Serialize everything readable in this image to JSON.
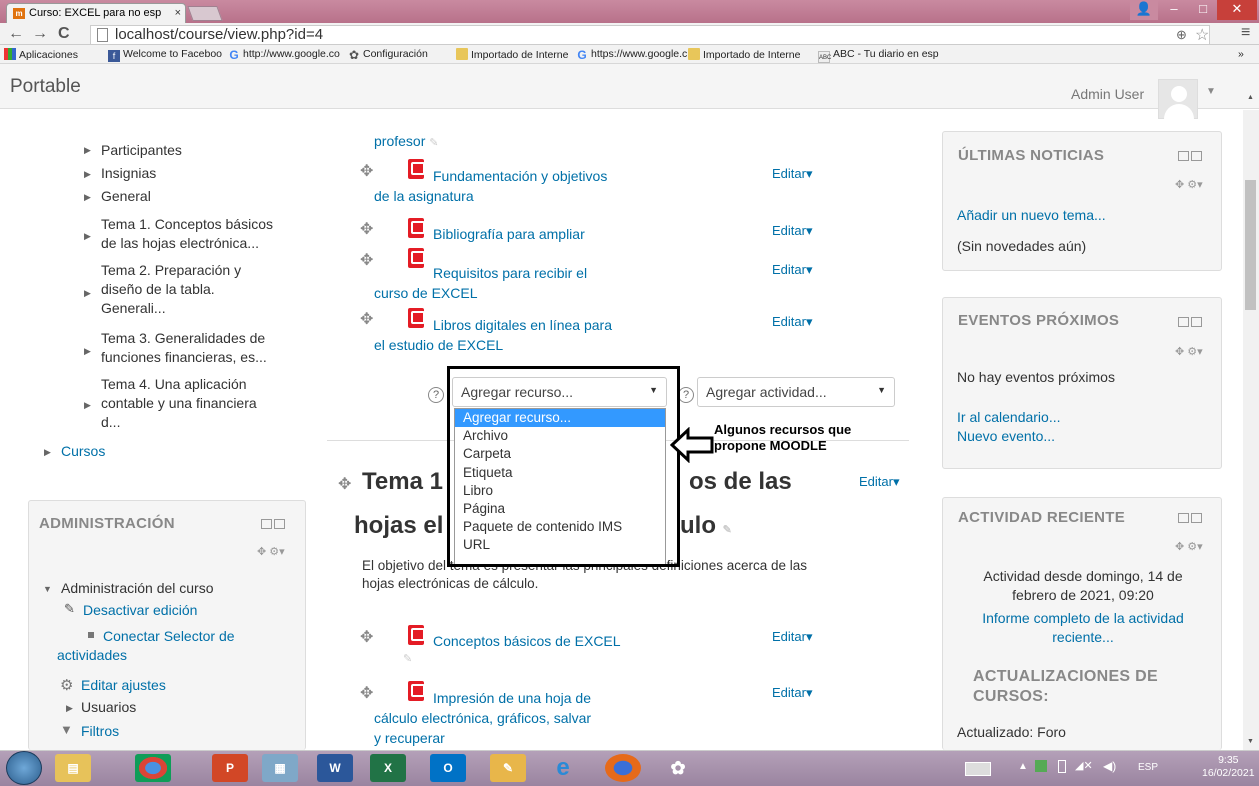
{
  "browser": {
    "tab_title": "Curso: EXCEL para no esp",
    "tab_close": "×",
    "url": "localhost/course/view.php?id=4",
    "zoom_glyph": "⊕",
    "star_glyph": "☆",
    "menu_glyph": "≡",
    "bookmarks": [
      {
        "label": "Aplicaciones",
        "icon": "apps-icon"
      },
      {
        "label": "Welcome to Faceboo",
        "icon": "facebook-icon"
      },
      {
        "label": "http://www.google.co",
        "icon": "google-icon"
      },
      {
        "label": "Configuración",
        "icon": "gear-icon"
      },
      {
        "label": "Importado de Interne",
        "icon": "folder-icon"
      },
      {
        "label": "https://www.google.c",
        "icon": "google-icon"
      },
      {
        "label": "Importado de Interne",
        "icon": "folder-icon"
      },
      {
        "label": "ABC - Tu diario en esp",
        "icon": "abc-icon"
      }
    ],
    "bookmarks_more": "»"
  },
  "header": {
    "brand": "Portable",
    "user": "Admin User"
  },
  "left_nav": {
    "items": [
      "Participantes",
      "Insignias",
      "General",
      "Tema 1. Conceptos básicos\nde las hojas electrónica...",
      "Tema 2. Preparación y\ndiseño de la tabla.\nGenerali...",
      "Tema 3. Generalidades de\nfunciones financieras, es...",
      "Tema 4. Una aplicación\ncontable y una financiera\nd..."
    ],
    "cursos": "Cursos"
  },
  "admin_block": {
    "title": "ADMINISTRACIÓN",
    "course_admin": "Administración del curso",
    "items": [
      "Desactivar edición",
      "Conectar Selector de actividades",
      "Editar ajustes",
      "Usuarios",
      "Filtros"
    ]
  },
  "center": {
    "top_fragment": "profesor",
    "resources": [
      {
        "title": "Fundamentación y objetivos\nde la asignatura"
      },
      {
        "title": "Bibliografía para ampliar"
      },
      {
        "title": "Requisitos para recibir el\ncurso de EXCEL"
      },
      {
        "title": "Libros digitales en línea para\nel estudio de EXCEL"
      }
    ],
    "edit_label": "Editar",
    "add_resource": "Agregar recurso...",
    "add_activity": "Agregar actividad...",
    "dropdown_options": [
      "Agregar recurso...",
      "Archivo",
      "Carpeta",
      "Etiqueta",
      "Libro",
      "Página",
      "Paquete de contenido IMS",
      "URL"
    ],
    "callout": "Algunos recursos que\npropone MOODLE",
    "topic_title_line1": "Tema 1",
    "topic_title_line1_tail": "os de las",
    "topic_title_line2_head": "hojas el",
    "topic_title_line2_tail": "ulo",
    "summary": "El objetivo del tema es presentar las principales definiciones acerca de las\nhojas electrónicas de cálculo.",
    "topic_resources": [
      {
        "title": "Conceptos básicos de EXCEL"
      },
      {
        "title": "Impresión de una hoja de\ncálculo electrónica, gráficos, salvar\ny recuperar"
      }
    ]
  },
  "right": {
    "news": {
      "title": "ÚLTIMAS NOTICIAS",
      "add": "Añadir un nuevo tema...",
      "empty": "(Sin novedades aún)"
    },
    "events": {
      "title": "EVENTOS PRÓXIMOS",
      "empty": "No hay eventos próximos",
      "calendar": "Ir al calendario...",
      "new": "Nuevo evento..."
    },
    "recent": {
      "title": "ACTIVIDAD RECIENTE",
      "since": "Actividad desde domingo, 14 de\nfebrero de 2021, 09:20",
      "report": "Informe completo de la actividad\nreciente...",
      "updates_title": "ACTUALIZACIONES DE\nCURSOS:",
      "updated": "Actualizado: Foro"
    }
  },
  "taskbar": {
    "apps": [
      "start-button",
      "explorer-icon",
      "chrome-icon",
      "powerpoint-icon",
      "calculator-icon",
      "word-icon",
      "excel-icon",
      "outlook-icon",
      "paint-icon",
      "ie-icon",
      "firefox-icon",
      "paint2-icon"
    ],
    "lang": "ESP",
    "time": "9:35",
    "date": "16/02/2021"
  },
  "colors": {
    "link": "#0070a8",
    "pdf": "#e41c25",
    "selected": "#3399ff",
    "titlebar": "#b8718a"
  }
}
